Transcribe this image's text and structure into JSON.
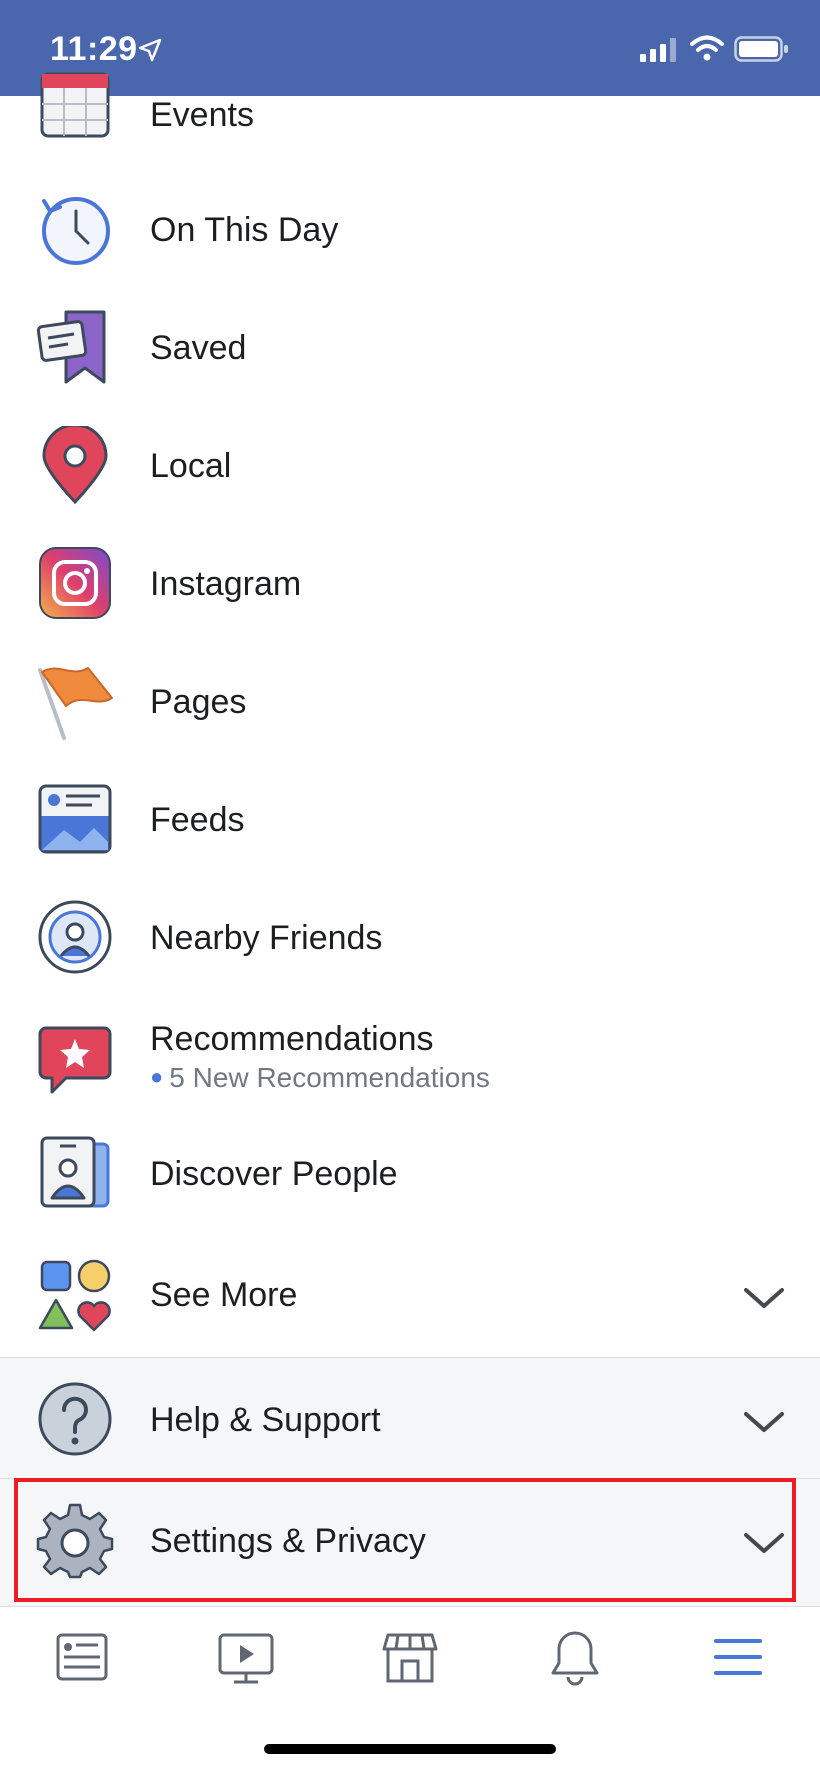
{
  "status_bar": {
    "time": "11:29"
  },
  "menu": {
    "items": [
      {
        "label": "Events",
        "icon": "calendar-icon"
      },
      {
        "label": "On This Day",
        "icon": "clock-icon"
      },
      {
        "label": "Saved",
        "icon": "bookmark-icon"
      },
      {
        "label": "Local",
        "icon": "map-pin-icon"
      },
      {
        "label": "Instagram",
        "icon": "instagram-icon"
      },
      {
        "label": "Pages",
        "icon": "flag-icon"
      },
      {
        "label": "Feeds",
        "icon": "feeds-icon"
      },
      {
        "label": "Nearby Friends",
        "icon": "nearby-friends-icon"
      },
      {
        "label": "Recommendations",
        "subtitle": "5 New Recommendations",
        "icon": "recommendations-icon"
      },
      {
        "label": "Discover People",
        "icon": "discover-people-icon"
      },
      {
        "label": "See More",
        "icon": "shapes-icon"
      }
    ],
    "help": {
      "label": "Help & Support",
      "icon": "question-icon"
    },
    "settings": {
      "label": "Settings & Privacy",
      "icon": "gear-icon"
    }
  },
  "tab_bar": {
    "tabs": [
      "news-feed-icon",
      "watch-icon",
      "marketplace-icon",
      "notifications-icon",
      "menu-icon"
    ],
    "active": "menu-icon"
  },
  "colors": {
    "status_bar": "#4a67ad",
    "highlight": "#ee1c25",
    "active_tab": "#4a76d8"
  }
}
